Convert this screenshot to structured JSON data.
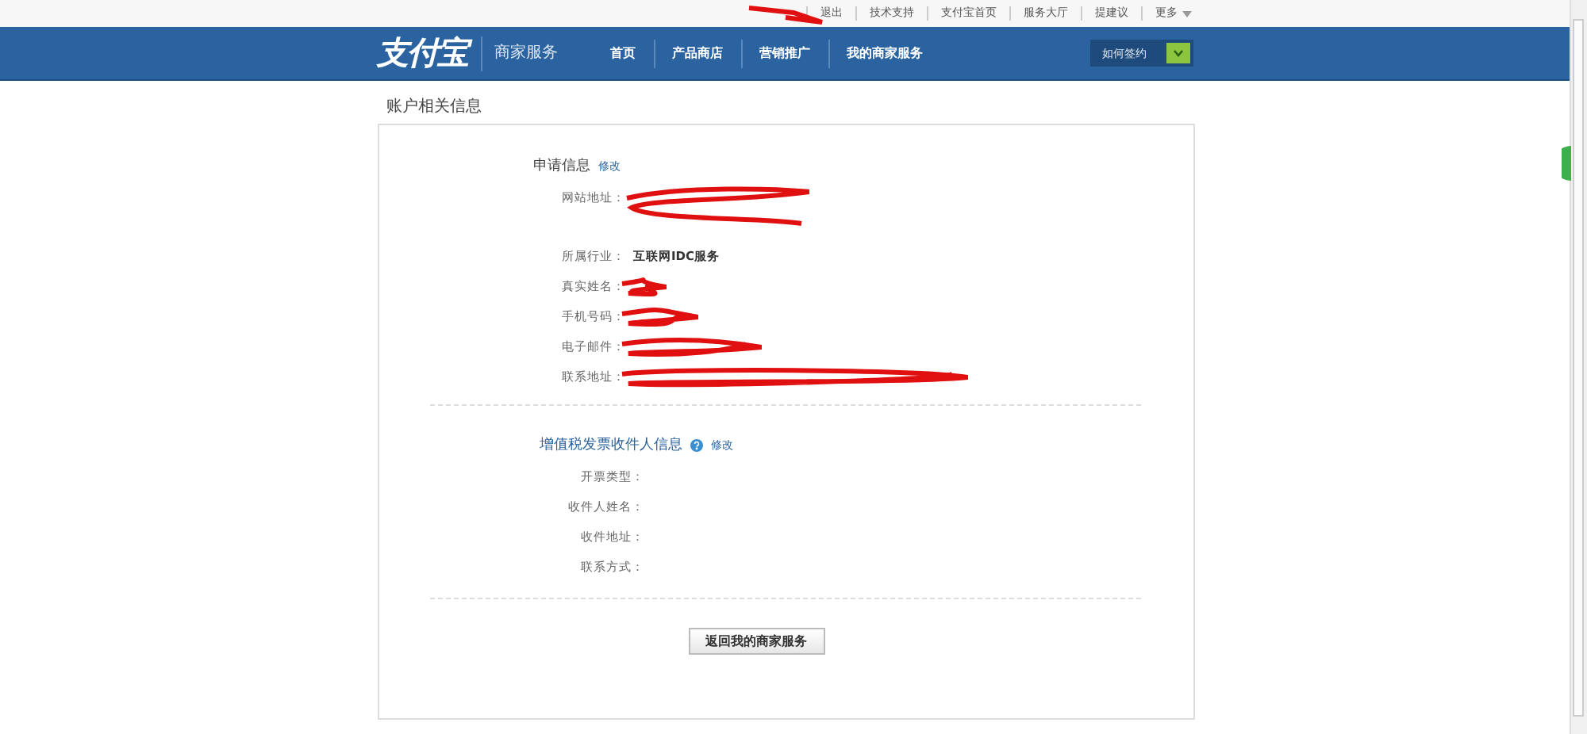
{
  "top_links": [
    "退出",
    "技术支持",
    "支付宝首页",
    "服务大厅",
    "提建议",
    "更多"
  ],
  "header": {
    "logo": "支付宝",
    "subtitle": "商家服务",
    "nav": [
      {
        "label": "首页",
        "selected": false
      },
      {
        "label": "产品商店",
        "selected": false
      },
      {
        "label": "营销推广",
        "selected": false
      },
      {
        "label": "我的商家服务",
        "selected": false
      }
    ],
    "sign_select": "如何签约"
  },
  "page_title": "账户相关信息",
  "sections": [
    {
      "title": "申请信息",
      "help": false,
      "edit": "修改",
      "rows": [
        {
          "label": "网站地址：",
          "redacted": true,
          "tall": true
        },
        {
          "label": "所属行业：",
          "value": "互联网IDC服务",
          "redacted": false
        },
        {
          "label": "真实姓名：",
          "redacted": true
        },
        {
          "label": "手机号码：",
          "redacted": true
        },
        {
          "label": "电子邮件：",
          "redacted": true
        },
        {
          "label": "联系地址：",
          "redacted": true
        }
      ]
    },
    {
      "title": "增值税发票收件人信息",
      "help": true,
      "edit": "修改",
      "rows": [
        {
          "label": "开票类型：",
          "redacted": false
        },
        {
          "label": "收件人姓名：",
          "redacted": false
        },
        {
          "label": "收件地址：",
          "redacted": false
        },
        {
          "label": "联系方式：",
          "redacted": false
        }
      ]
    }
  ],
  "back_button": "返回我的商家服务"
}
